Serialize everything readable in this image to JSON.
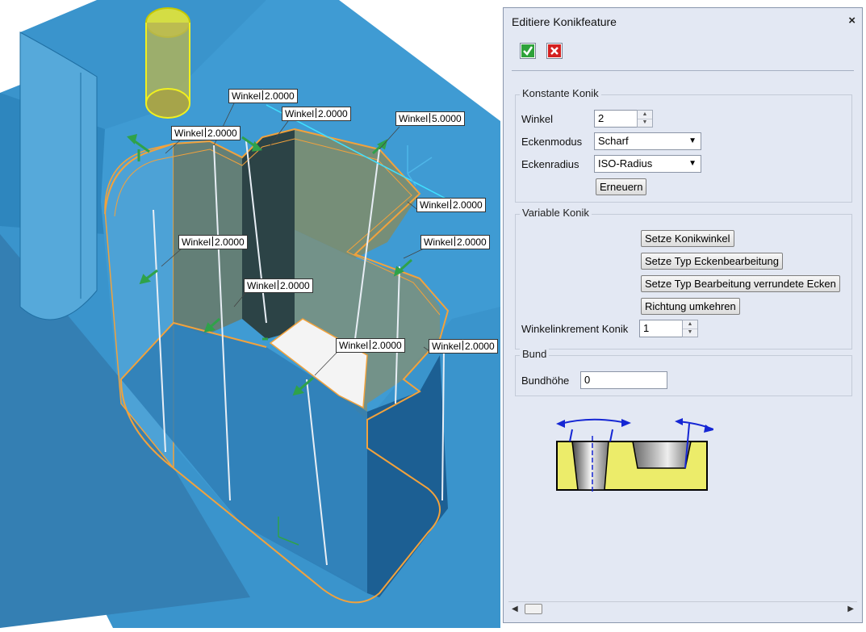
{
  "viewport": {
    "dimension_prefix": "Winkel",
    "dimension_values": [
      "2.0000",
      "2.0000",
      "2.0000",
      "5.0000",
      "2.0000",
      "2.0000",
      "2.0000",
      "2.0000",
      "2.0000",
      "2.0000"
    ],
    "colors": {
      "stock": "#3a94cc",
      "edges": "#f2a23c",
      "arrows": "#2fa24a",
      "tool": "#f0f020"
    }
  },
  "dialog": {
    "title": "Editiere Konikfeature",
    "close_glyph": "×",
    "ok_icon": "checkmark-icon",
    "cancel_icon": "cancel-x-icon",
    "constant": {
      "title": "Konstante Konik",
      "angle_label": "Winkel",
      "angle_value": "2",
      "corner_mode_label": "Eckenmodus",
      "corner_mode_value": "Scharf",
      "corner_radius_label": "Eckenradius",
      "corner_radius_value": "ISO-Radius",
      "refresh_button": "Erneuern"
    },
    "variable": {
      "title": "Variable Konik",
      "set_angle_button": "Setze Konikwinkel",
      "set_corner_type_button": "Setze Typ Eckenbearbeitung",
      "set_rounded_type_button": "Setze Typ Bearbeitung verrundete Ecken",
      "reverse_button": "Richtung umkehren",
      "increment_label": "Winkelinkrement Konik",
      "increment_value": "1"
    },
    "collar": {
      "title": "Bund",
      "height_label": "Bundhöhe",
      "height_value": "0"
    },
    "colors": {
      "panel_bg": "#e3e8f3",
      "illustration_fill": "#ecec6a",
      "illustration_line": "#1526d4"
    }
  }
}
